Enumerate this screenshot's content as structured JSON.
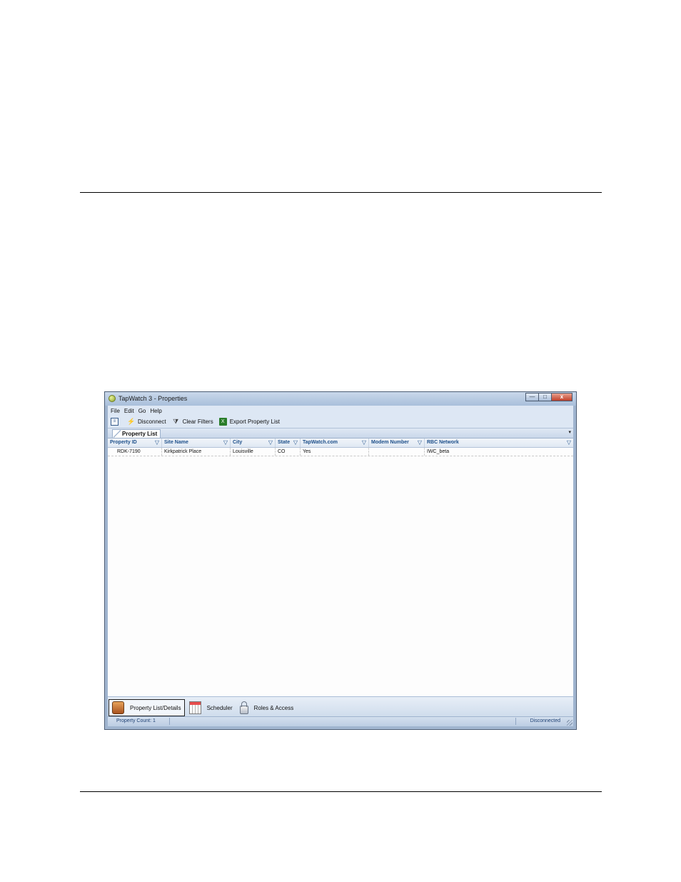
{
  "window": {
    "title": "TapWatch 3 - Properties",
    "controls": {
      "minimize": "—",
      "maximize": "□",
      "close": "x"
    }
  },
  "menu": [
    "File",
    "Edit",
    "Go",
    "Help"
  ],
  "toolbar": {
    "properties_icon": "properties-icon",
    "disconnect_label": "Disconnect",
    "clear_filters_label": "Clear Filters",
    "export_label": "Export Property List"
  },
  "tab": {
    "label": "Property List",
    "dropdown": "▾"
  },
  "grid": {
    "columns": [
      "Property ID",
      "Site Name",
      "City",
      "State",
      "TapWatch.com",
      "Modem Number",
      "RBC Network"
    ],
    "filter_glyph": "▽",
    "rows": [
      [
        "RDK-7190",
        "Kirkpatrick Place",
        "Louisville",
        "CO",
        "Yes",
        "",
        "IWC_beta"
      ]
    ]
  },
  "nav": {
    "items": [
      {
        "label": "Property List/Details",
        "icon": "folder-icon",
        "active": true
      },
      {
        "label": "Scheduler",
        "icon": "calendar-icon",
        "active": false
      },
      {
        "label": "Roles & Access",
        "icon": "lock-icon",
        "active": false
      }
    ]
  },
  "status": {
    "count_label": "Property Count: 1",
    "connection": "Disconnected"
  },
  "colors": {
    "header_text": "#1d4f8a",
    "window_frame": "#9fb4cf",
    "client_bg": "#dde7f4"
  }
}
